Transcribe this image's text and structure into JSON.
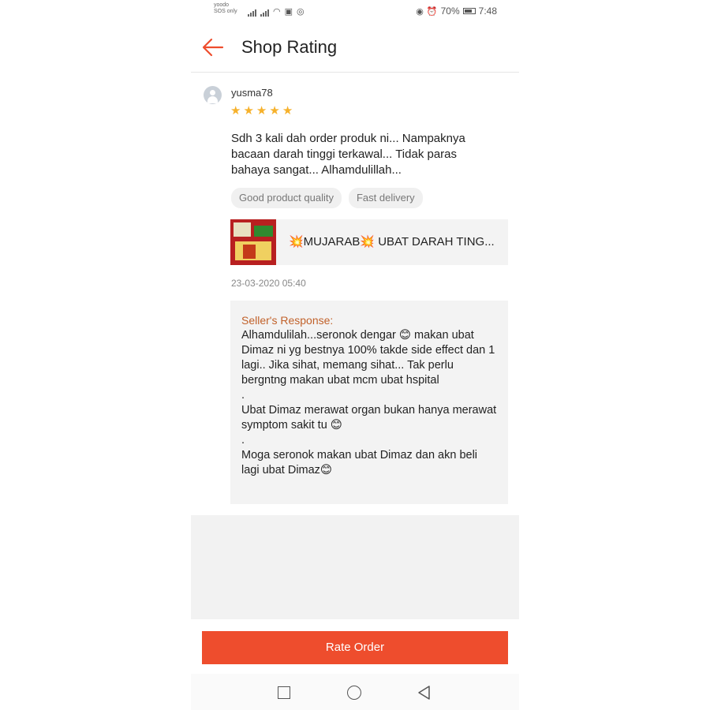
{
  "status_bar": {
    "carrier_line1": "yoodo",
    "carrier_line2": "SOS only",
    "battery": "70%",
    "time": "7:48"
  },
  "header": {
    "title": "Shop Rating"
  },
  "review": {
    "username": "yusma78",
    "rating": 5,
    "rating_stars": "★★★★★",
    "text": "Sdh 3 kali dah order produk ni... Nampaknya bacaan darah tinggi terkawal... Tidak paras bahaya sangat... Alhamdulillah...",
    "tags": [
      "Good product quality",
      "Fast delivery"
    ],
    "product": {
      "name": "💥MUJARAB💥 UBAT DARAH TING..."
    },
    "timestamp": "23-03-2020 05:40"
  },
  "seller_response": {
    "title": "Seller's Response:",
    "text": "Alhamdulilah...seronok dengar 😊 makan ubat Dimaz ni yg bestnya 100% takde side effect dan 1 lagi.. Jika sihat,  memang sihat... Tak perlu bergntng makan ubat mcm ubat hspital\n.\nUbat Dimaz merawat organ bukan hanya merawat symptom sakit tu 😊\n.\nMoga seronok makan ubat Dimaz dan akn beli lagi ubat Dimaz😊"
  },
  "action": {
    "rate_order_label": "Rate Order"
  },
  "colors": {
    "accent": "#ee4d2d",
    "star": "#f6b12b",
    "seller_title": "#c1612a"
  }
}
